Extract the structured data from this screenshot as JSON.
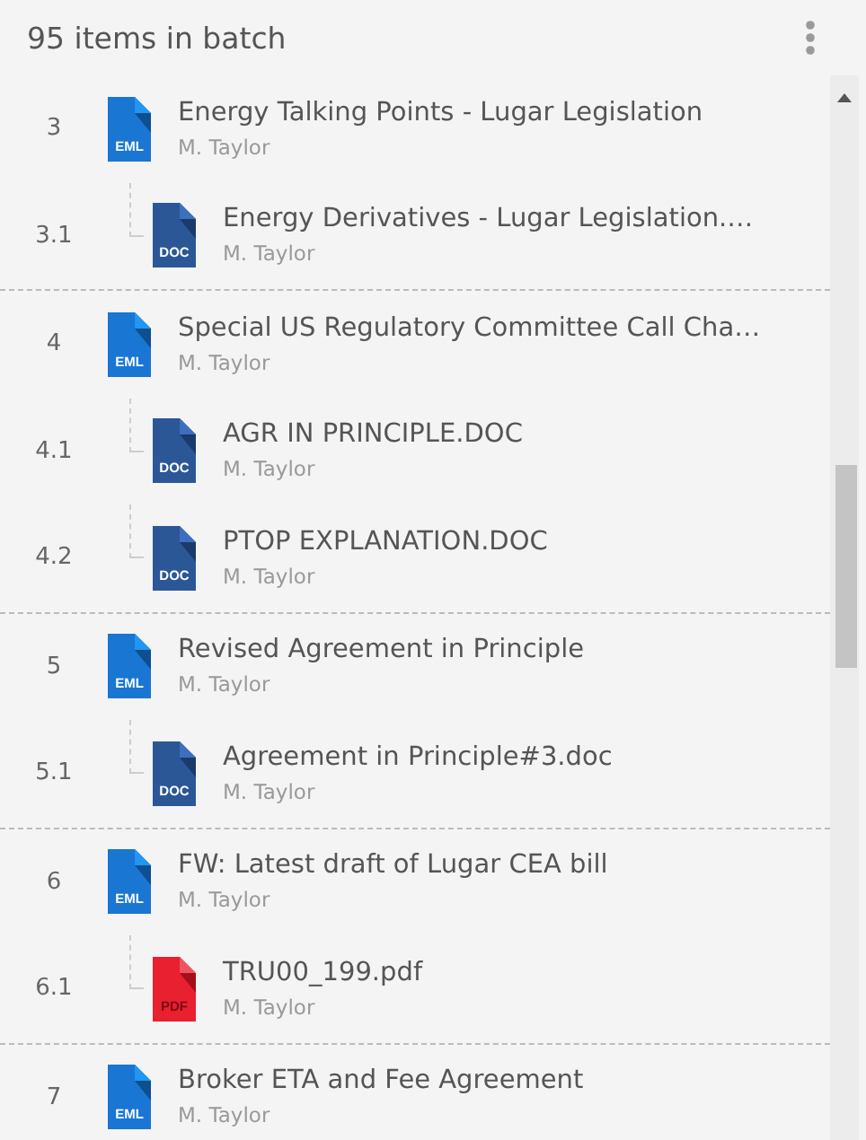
{
  "header": {
    "title": "95 items in batch"
  },
  "groups": [
    {
      "number": "3",
      "title": "Energy Talking Points - Lugar Legislation",
      "author": "M. Taylor",
      "kind": "eml",
      "badge": "EML",
      "children": [
        {
          "number": "3.1",
          "title": "Energy Derivatives - Lugar Legislation.…",
          "author": "M. Taylor",
          "kind": "doc",
          "badge": "DOC"
        }
      ]
    },
    {
      "number": "4",
      "title": "Special US Regulatory Committee Call Cha…",
      "author": "M. Taylor",
      "kind": "eml",
      "badge": "EML",
      "children": [
        {
          "number": "4.1",
          "title": "AGR IN PRINCIPLE.DOC",
          "author": "M. Taylor",
          "kind": "doc",
          "badge": "DOC"
        },
        {
          "number": "4.2",
          "title": "PTOP EXPLANATION.DOC",
          "author": "M. Taylor",
          "kind": "doc",
          "badge": "DOC"
        }
      ]
    },
    {
      "number": "5",
      "title": "Revised Agreement in Principle",
      "author": "M. Taylor",
      "kind": "eml",
      "badge": "EML",
      "children": [
        {
          "number": "5.1",
          "title": "Agreement in Principle#3.doc",
          "author": "M. Taylor",
          "kind": "doc",
          "badge": "DOC"
        }
      ]
    },
    {
      "number": "6",
      "title": "FW: Latest draft of Lugar CEA bill",
      "author": "M. Taylor",
      "kind": "eml",
      "badge": "EML",
      "children": [
        {
          "number": "6.1",
          "title": "TRU00_199.pdf",
          "author": "M. Taylor",
          "kind": "pdf",
          "badge": "PDF"
        }
      ]
    },
    {
      "number": "7",
      "title": "Broker ETA and Fee Agreement",
      "author": "M. Taylor",
      "kind": "eml",
      "badge": "EML"
    }
  ]
}
